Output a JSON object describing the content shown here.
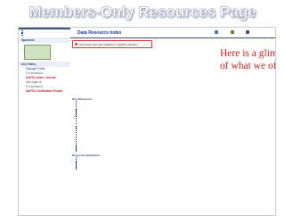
{
  "slide": {
    "title": "Members-Only Resources Page"
  },
  "callout": {
    "line1": "Here is a glimpse",
    "line2": "of what we offer…"
  },
  "colors": {
    "brand": "#3d4f7c",
    "link": "#1a3e8f",
    "callout": "#cc2222"
  },
  "page": {
    "header_title": "Data Resource Index",
    "header_buttons": [
      "",
      "",
      ""
    ],
    "notice": "Resources are only available to SAFSA members"
  },
  "sidebar": {
    "head": "",
    "items": [
      "",
      "",
      ""
    ],
    "sponsors_label": "Sponsors",
    "sponsor_box_text": "",
    "user_menu_label": "User Menu",
    "user_lines": [
      {
        "text": "Manage Profile",
        "style": "blue"
      },
      {
        "text": "For access to",
        "style": "plain"
      },
      {
        "text": "SAFSA online Journal",
        "style": "red"
      },
      {
        "text": "click login or",
        "style": "plain"
      },
      {
        "text": "",
        "style": "blue"
      },
      {
        "text": "For access to",
        "style": "plain"
      },
      {
        "text": "SAFSA Certification Exams",
        "style": "red"
      },
      {
        "text": "",
        "style": "plain"
      },
      {
        "text": "",
        "style": "blue"
      }
    ]
  },
  "main": {
    "key_resources_heading": "Key Resources",
    "key_resources": [
      "",
      "",
      "",
      "",
      "",
      "",
      "",
      "",
      "",
      "",
      "",
      "",
      ""
    ],
    "dataset_heading": "",
    "datasets": [
      "",
      "",
      "",
      "",
      "",
      "",
      "",
      "",
      "",
      "",
      "",
      "",
      "",
      ""
    ],
    "drug_free_heading": "Drug Free Workplace",
    "drug_free": [
      "",
      "",
      "",
      "",
      "",
      "",
      ""
    ]
  }
}
